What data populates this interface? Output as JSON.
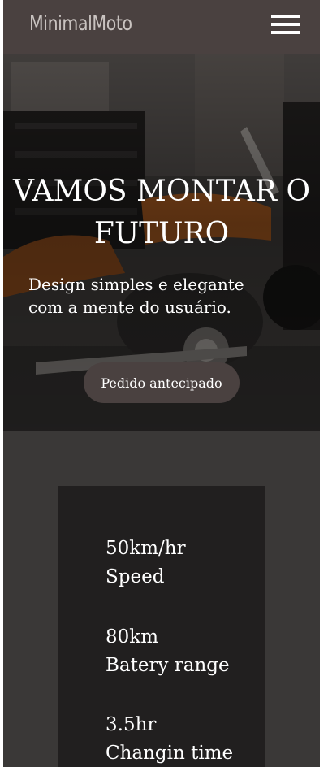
{
  "header": {
    "logo": "MinimalMoto",
    "menu_icon": "hamburger-menu-icon"
  },
  "hero": {
    "title": "VAMOS MONTAR O FUTURO",
    "subtitle": "Design simples e elegante com a mente do usuário.",
    "cta_label": "Pedido antecipado"
  },
  "stats": [
    {
      "value": "50km/hr",
      "label": "Speed"
    },
    {
      "value": "80km",
      "label": "Batery range"
    },
    {
      "value": "3.5hr",
      "label": "Changin time"
    }
  ],
  "colors": {
    "header_bg": "#4a4140",
    "page_bg": "#3a3837",
    "card_bg": "#211f1f",
    "button_bg": "#4a4140",
    "text": "#ffffff"
  }
}
